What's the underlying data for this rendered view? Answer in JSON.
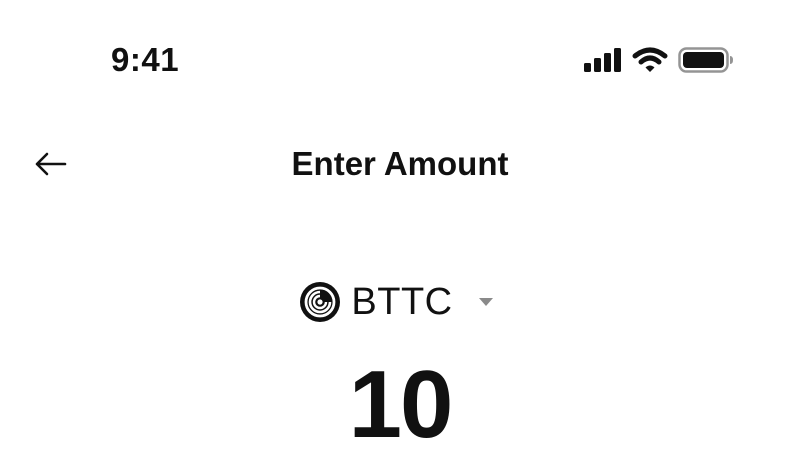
{
  "status_bar": {
    "time": "9:41",
    "icons": [
      "signal-icon",
      "wifi-icon",
      "battery-icon"
    ]
  },
  "header": {
    "back_icon": "arrow-left-icon",
    "title": "Enter Amount"
  },
  "token": {
    "icon": "bttc-logo-icon",
    "symbol": "BTTC",
    "dropdown_icon": "caret-down-icon"
  },
  "amount": {
    "value": "10"
  },
  "colors": {
    "text": "#111111",
    "caret": "#8a8a8a",
    "background": "#ffffff"
  }
}
